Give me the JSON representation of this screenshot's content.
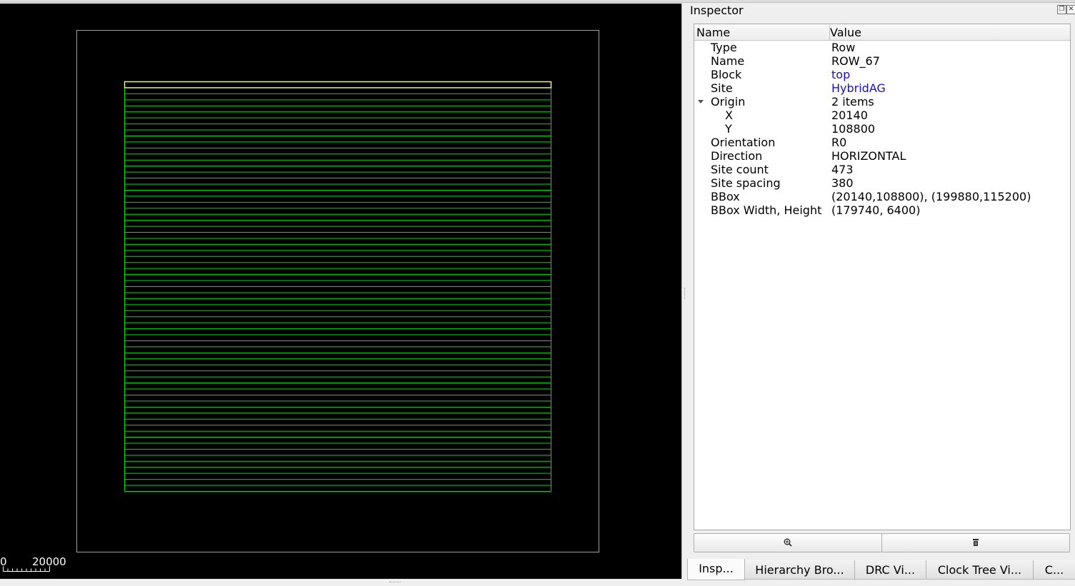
{
  "layout_view": {
    "background": "#000000",
    "die_outline_color": "#a0a0a0",
    "row_color": "#00e000",
    "selected_row_color": "#e8f08a",
    "row_count": 68,
    "selected_row_index": 67,
    "scale_bar": {
      "labels": [
        "0",
        "20000"
      ]
    }
  },
  "inspector": {
    "title": "Inspector",
    "float_icon": "float-icon",
    "close_icon": "close-icon",
    "columns": {
      "name": "Name",
      "value": "Value"
    },
    "properties": [
      {
        "name": "Type",
        "value": "Row"
      },
      {
        "name": "Name",
        "value": "ROW_67"
      },
      {
        "name": "Block",
        "value": "top",
        "link": true
      },
      {
        "name": "Site",
        "value": "HybridAG",
        "link": true
      },
      {
        "name": "Origin",
        "value": "2 items",
        "expanded": true
      },
      {
        "name": "X",
        "value": "20140",
        "child": true
      },
      {
        "name": "Y",
        "value": "108800",
        "child": true
      },
      {
        "name": "Orientation",
        "value": "R0"
      },
      {
        "name": "Direction",
        "value": "HORIZONTAL"
      },
      {
        "name": "Site count",
        "value": "473"
      },
      {
        "name": "Site spacing",
        "value": "380"
      },
      {
        "name": "BBox",
        "value": "(20140,108800), (199880,115200)"
      },
      {
        "name": "BBox Width, Height",
        "value": "(179740, 6400)"
      }
    ],
    "buttons": {
      "zoom_icon": "zoom-in-icon",
      "delete_icon": "trash-icon"
    }
  },
  "tabs": [
    {
      "label": "Insp...",
      "active": true
    },
    {
      "label": "Hierarchy Bro..."
    },
    {
      "label": "DRC Vi..."
    },
    {
      "label": "Clock Tree Vi..."
    },
    {
      "label": "C..."
    }
  ]
}
